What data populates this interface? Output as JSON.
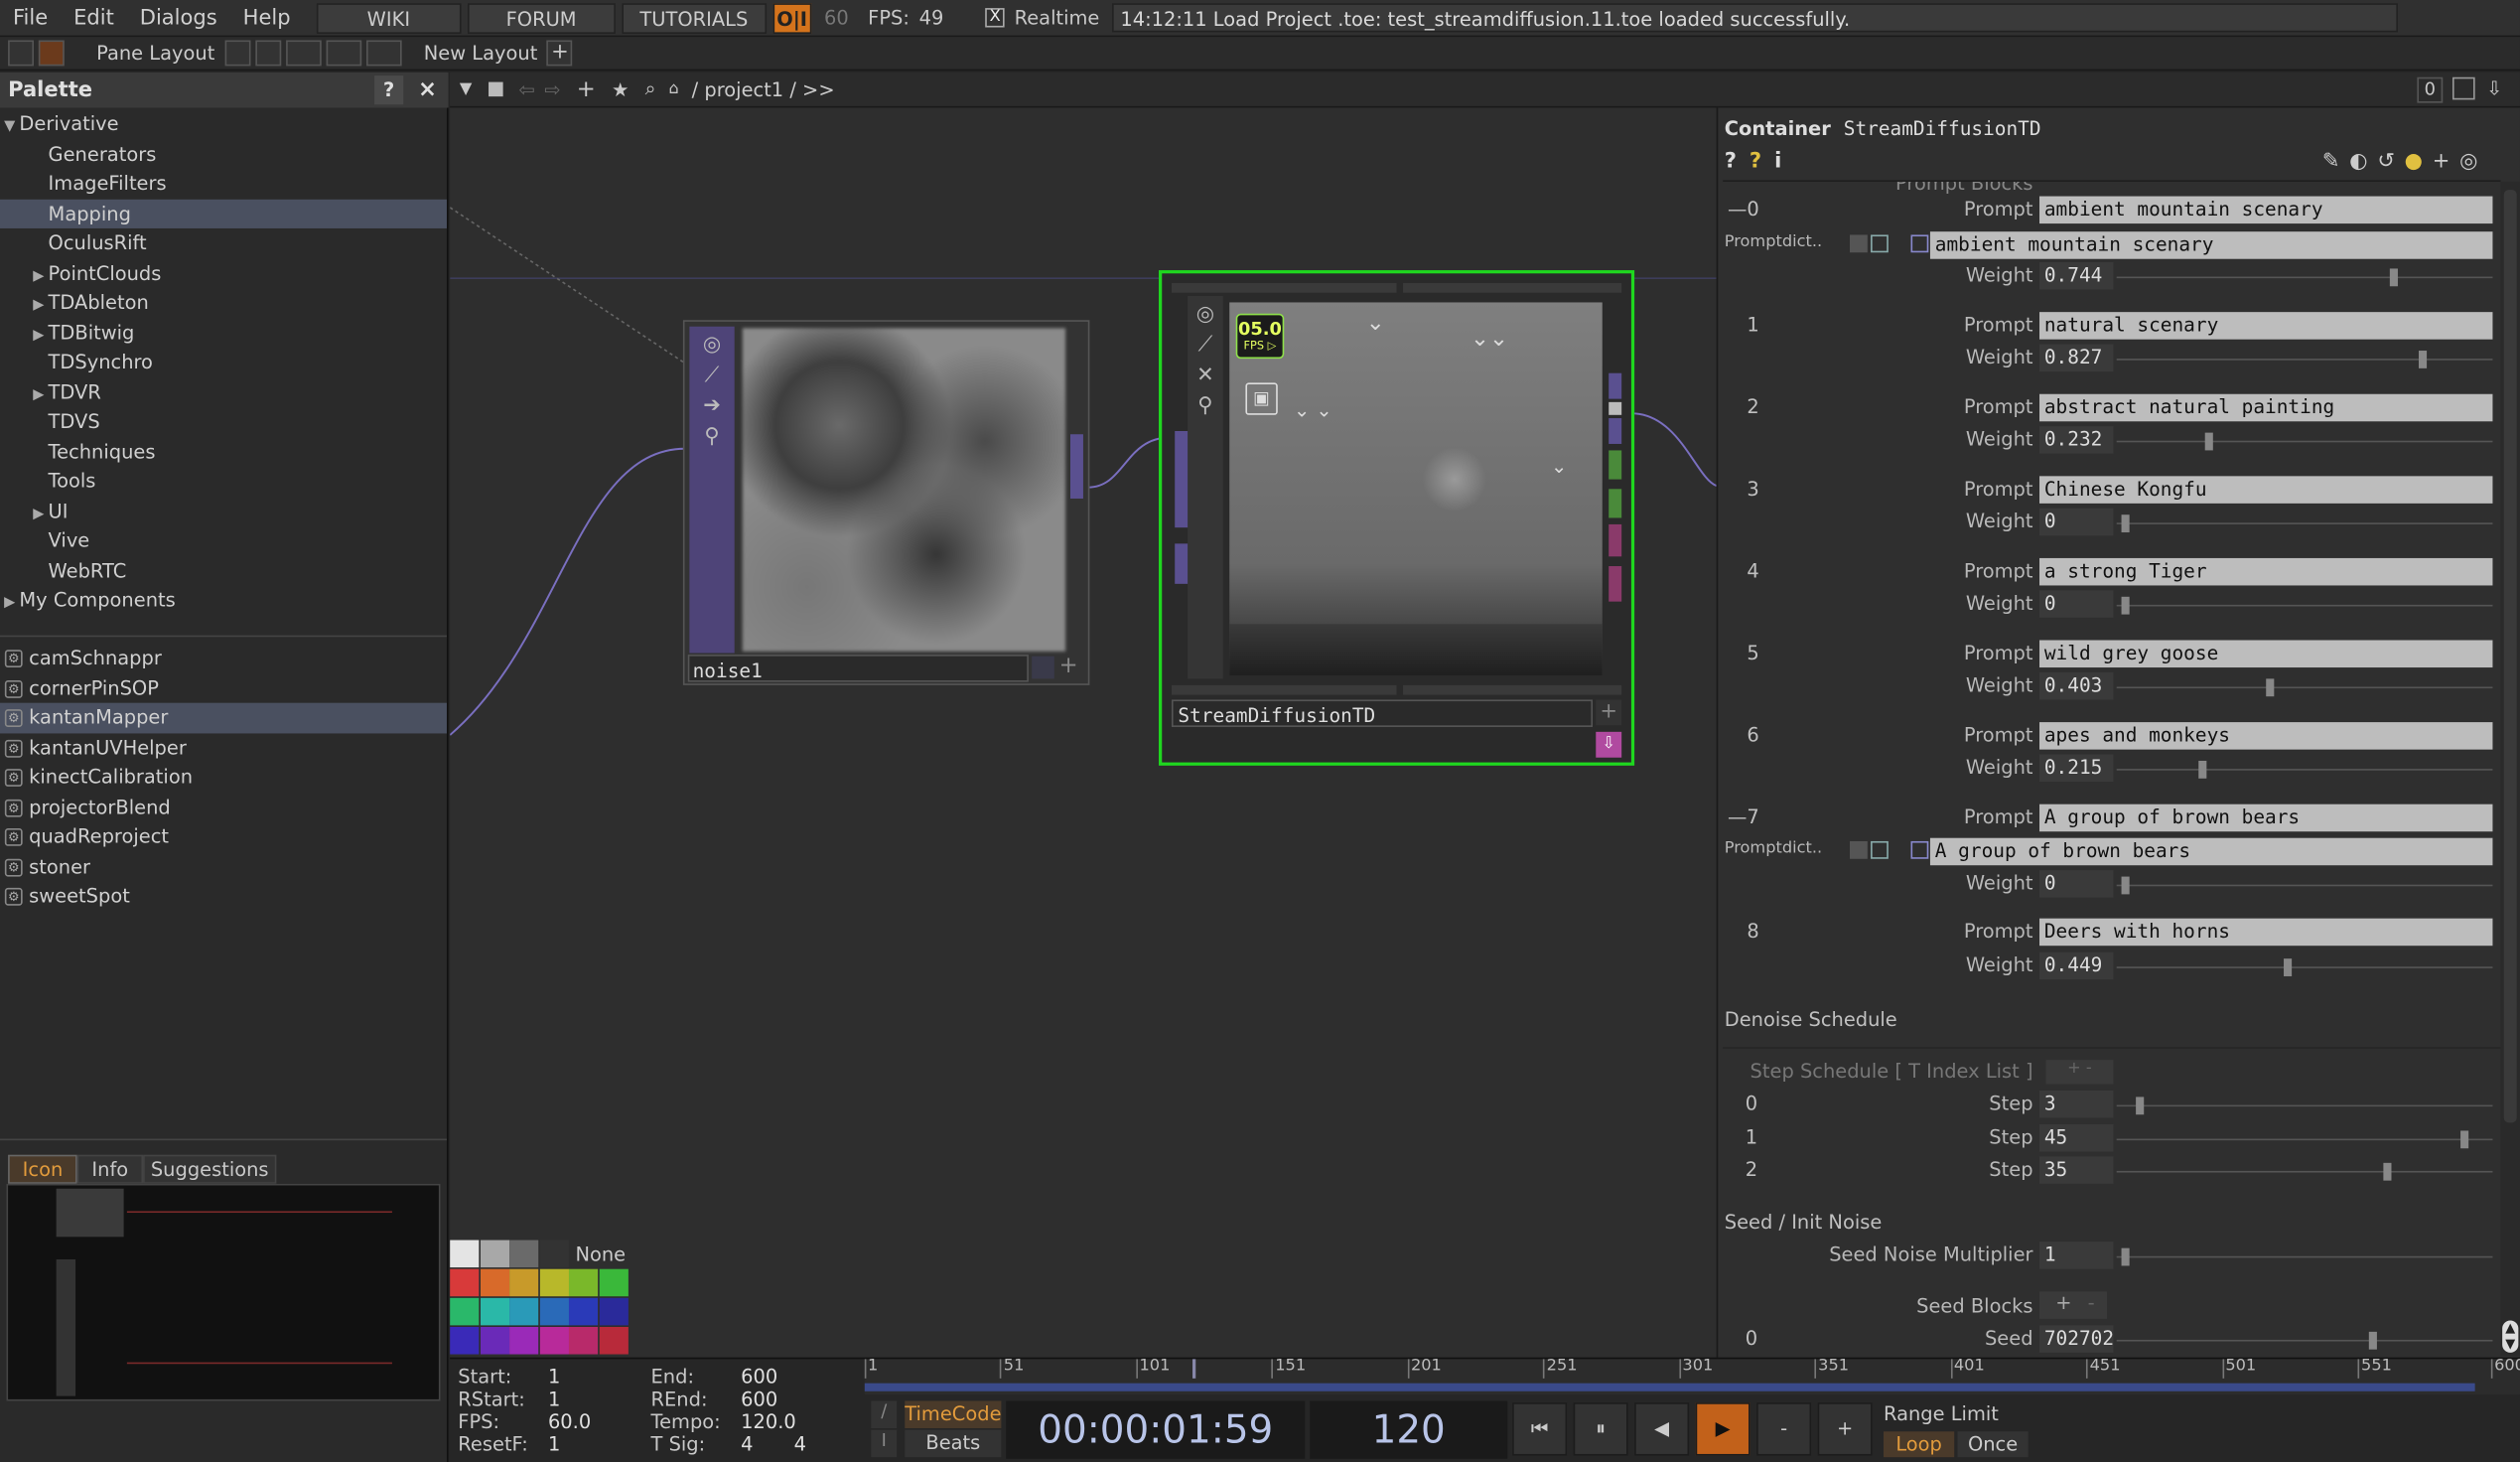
{
  "menubar": {
    "menus": [
      "File",
      "Edit",
      "Dialogs",
      "Help"
    ],
    "wiki": "WIKI",
    "forum": "FORUM",
    "tutorials": "TUTORIALS",
    "oi": "O|I",
    "fps_target": "60",
    "fps_label": "FPS:",
    "fps_value": "49",
    "realtime_check": "X",
    "realtime_label": "Realtime",
    "status": "14:12:11 Load Project .toe: test_streamdiffusion.11.toe loaded successfully."
  },
  "toolbar2": {
    "pane_layout": "Pane Layout",
    "new_layout": "New Layout",
    "plus": "+"
  },
  "palette": {
    "title": "Palette",
    "help": "?",
    "close": "×",
    "root": "Derivative",
    "items": [
      {
        "label": "Generators",
        "arrow": "",
        "selected": false
      },
      {
        "label": "ImageFilters",
        "arrow": "",
        "selected": false
      },
      {
        "label": "Mapping",
        "arrow": "",
        "selected": true
      },
      {
        "label": "OculusRift",
        "arrow": "",
        "selected": false
      },
      {
        "label": "PointClouds",
        "arrow": "▶",
        "selected": false
      },
      {
        "label": "TDAbleton",
        "arrow": "▶",
        "selected": false
      },
      {
        "label": "TDBitwig",
        "arrow": "▶",
        "selected": false
      },
      {
        "label": "TDSynchro",
        "arrow": "",
        "selected": false
      },
      {
        "label": "TDVR",
        "arrow": "▶",
        "selected": false
      },
      {
        "label": "TDVS",
        "arrow": "",
        "selected": false
      },
      {
        "label": "Techniques",
        "arrow": "",
        "selected": false
      },
      {
        "label": "Tools",
        "arrow": "",
        "selected": false
      },
      {
        "label": "UI",
        "arrow": "▶",
        "selected": false
      },
      {
        "label": "Vive",
        "arrow": "",
        "selected": false
      },
      {
        "label": "WebRTC",
        "arrow": "",
        "selected": false
      }
    ],
    "my_components": "My Components",
    "components": [
      {
        "label": "camSchnappr",
        "selected": false
      },
      {
        "label": "cornerPinSOP",
        "selected": false
      },
      {
        "label": "kantanMapper",
        "selected": true
      },
      {
        "label": "kantanUVHelper",
        "selected": false
      },
      {
        "label": "kinectCalibration",
        "selected": false
      },
      {
        "label": "projectorBlend",
        "selected": false
      },
      {
        "label": "quadReproject",
        "selected": false
      },
      {
        "label": "stoner",
        "selected": false
      },
      {
        "label": "sweetSpot",
        "selected": false
      }
    ],
    "tabs": [
      "Icon",
      "Info",
      "Suggestions"
    ]
  },
  "netbar": {
    "path": "/ project1 / >>",
    "zoom_value": "0"
  },
  "network": {
    "noise_label": "noise1",
    "sd_label": "StreamDiffusionTD",
    "fps_badge_top": "05.0",
    "fps_badge_bottom": "FPS ▷",
    "color_none": "None"
  },
  "params": {
    "type_label": "Container",
    "name": "StreamDiffusionTD",
    "prompt_blocks_label": "Prompt Blocks",
    "prompt_label": "Prompt",
    "weight_label": "Weight",
    "promptdict_label": "Promptdict..",
    "prompts": [
      {
        "index": "0",
        "collapse": "—",
        "text": "ambient mountain scenary",
        "weight": "0.744",
        "w": 0.744,
        "dict": "ambient mountain scenary"
      },
      {
        "index": "1",
        "collapse": "",
        "text": "natural scenary",
        "weight": "0.827",
        "w": 0.827,
        "dict": ""
      },
      {
        "index": "2",
        "collapse": "",
        "text": "abstract natural painting",
        "weight": "0.232",
        "w": 0.232,
        "dict": ""
      },
      {
        "index": "3",
        "collapse": "",
        "text": "Chinese Kongfu",
        "weight": "0",
        "w": 0,
        "dict": ""
      },
      {
        "index": "4",
        "collapse": "",
        "text": "a strong Tiger",
        "weight": "0",
        "w": 0,
        "dict": ""
      },
      {
        "index": "5",
        "collapse": "",
        "text": "wild grey goose",
        "weight": "0.403",
        "w": 0.403,
        "dict": ""
      },
      {
        "index": "6",
        "collapse": "",
        "text": "apes and monkeys",
        "weight": "0.215",
        "w": 0.215,
        "dict": ""
      },
      {
        "index": "7",
        "collapse": "—",
        "text": "A group of brown bears",
        "weight": "0",
        "w": 0,
        "dict": "A group of brown bears"
      },
      {
        "index": "8",
        "collapse": "",
        "text": "Deers with horns",
        "weight": "0.449",
        "w": 0.449,
        "dict": ""
      }
    ],
    "denoise_title": "Denoise Schedule",
    "step_schedule_label": "Step Schedule [ T Index List ]",
    "step_label": "Step",
    "steps": [
      {
        "index": "0",
        "value": "3",
        "frac": 0.04
      },
      {
        "index": "1",
        "value": "45",
        "frac": 0.96
      },
      {
        "index": "2",
        "value": "35",
        "frac": 0.74
      }
    ],
    "seed_title": "Seed / Init Noise",
    "seed_mult_label": "Seed Noise Multiplier",
    "seed_mult_value": "1",
    "seed_blocks_label": "Seed Blocks",
    "seed_label": "Seed",
    "seed_index": "0",
    "seed_value": "702702",
    "seed_frac": 0.7
  },
  "timeline": {
    "start_label": "Start:",
    "start": "1",
    "rstart_label": "RStart:",
    "rstart": "1",
    "fps_label": "FPS:",
    "fps": "60.0",
    "resetf_label": "ResetF:",
    "resetf": "1",
    "end_label": "End:",
    "end": "600",
    "rend_label": "REnd:",
    "rend": "600",
    "tempo_label": "Tempo:",
    "tempo": "120.0",
    "tsig_label": "T Sig:",
    "tsig_a": "4",
    "tsig_b": "4",
    "ruler_ticks": [
      "1",
      "51",
      "101",
      "151",
      "201",
      "251",
      "301",
      "351",
      "401",
      "451",
      "501",
      "551",
      "600"
    ],
    "timecode_btn": "TimeCode",
    "beats_btn": "Beats",
    "timecode": "00:00:01:59",
    "frame": "120",
    "range_limit": "Range Limit",
    "loop": "Loop",
    "once": "Once",
    "slash": "/",
    "bar": "I",
    "minus": "-",
    "plus": "+"
  }
}
